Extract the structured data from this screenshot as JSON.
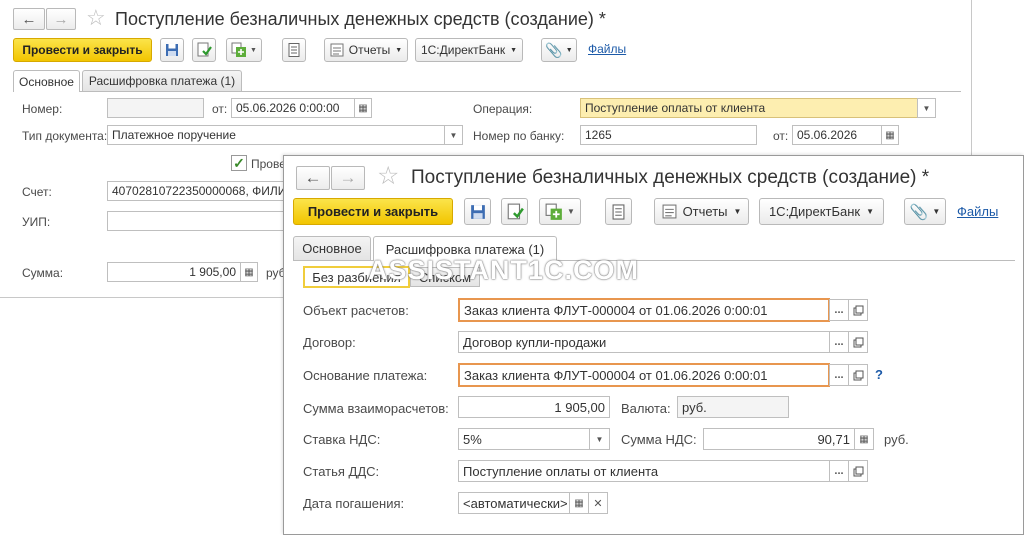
{
  "window_back": {
    "title": "Поступление безналичных денежных средств (создание) *",
    "toolbar": {
      "post_close": "Провести и закрыть",
      "reports": "Отчеты",
      "directbank": "1С:ДиректБанк",
      "files": "Файлы"
    },
    "tabs": [
      "Основное",
      "Расшифровка платежа (1)"
    ],
    "fields": {
      "number_label": "Номер:",
      "number_value": "",
      "from_label": "от:",
      "date_value": "05.06.2026  0:00:00",
      "operation_label": "Операция:",
      "operation_value": "Поступление оплаты от клиента",
      "doctype_label": "Тип документа:",
      "doctype_value": "Платежное поручение",
      "banknum_label": "Номер по банку:",
      "banknum_value": "1265",
      "from2_label": "от:",
      "bankdate_value": "05.06.2026",
      "checkbox_label": "Прове",
      "account_label": "Счет:",
      "account_value": "40702810722350000068, ФИЛИА",
      "uip_label": "УИП:",
      "uip_value": "",
      "sum_label": "Сумма:",
      "sum_value": "1 905,00",
      "sum_currency": "руб"
    }
  },
  "window_front": {
    "title": "Поступление безналичных денежных средств (создание) *",
    "toolbar": {
      "post_close": "Провести и закрыть",
      "reports": "Отчеты",
      "directbank": "1С:ДиректБанк",
      "files": "Файлы"
    },
    "tabs": [
      "Основное",
      "Расшифровка платежа (1)"
    ],
    "view_switch": [
      "Без разбиения",
      "Списком"
    ],
    "fields": {
      "settlement_object_label": "Объект расчетов:",
      "settlement_object_value": "Заказ клиента ФЛУТ-000004 от 01.06.2026 0:00:01",
      "contract_label": "Договор:",
      "contract_value": "Договор купли-продажи",
      "basis_label": "Основание платежа:",
      "basis_value": "Заказ клиента ФЛУТ-000004 от 01.06.2026 0:00:01",
      "mutual_sum_label": "Сумма взаиморасчетов:",
      "mutual_sum_value": "1 905,00",
      "currency_label": "Валюта:",
      "currency_value": "руб.",
      "vat_rate_label": "Ставка НДС:",
      "vat_rate_value": "5%",
      "vat_sum_label": "Сумма НДС:",
      "vat_sum_value": "90,71",
      "vat_currency": "руб.",
      "dds_label": "Статья ДДС:",
      "dds_value": "Поступление оплаты от клиента",
      "due_date_label": "Дата погашения:",
      "due_date_value": "<автоматически>"
    },
    "help_mark": "?"
  },
  "watermark": "ASSISTANT1C.COM"
}
